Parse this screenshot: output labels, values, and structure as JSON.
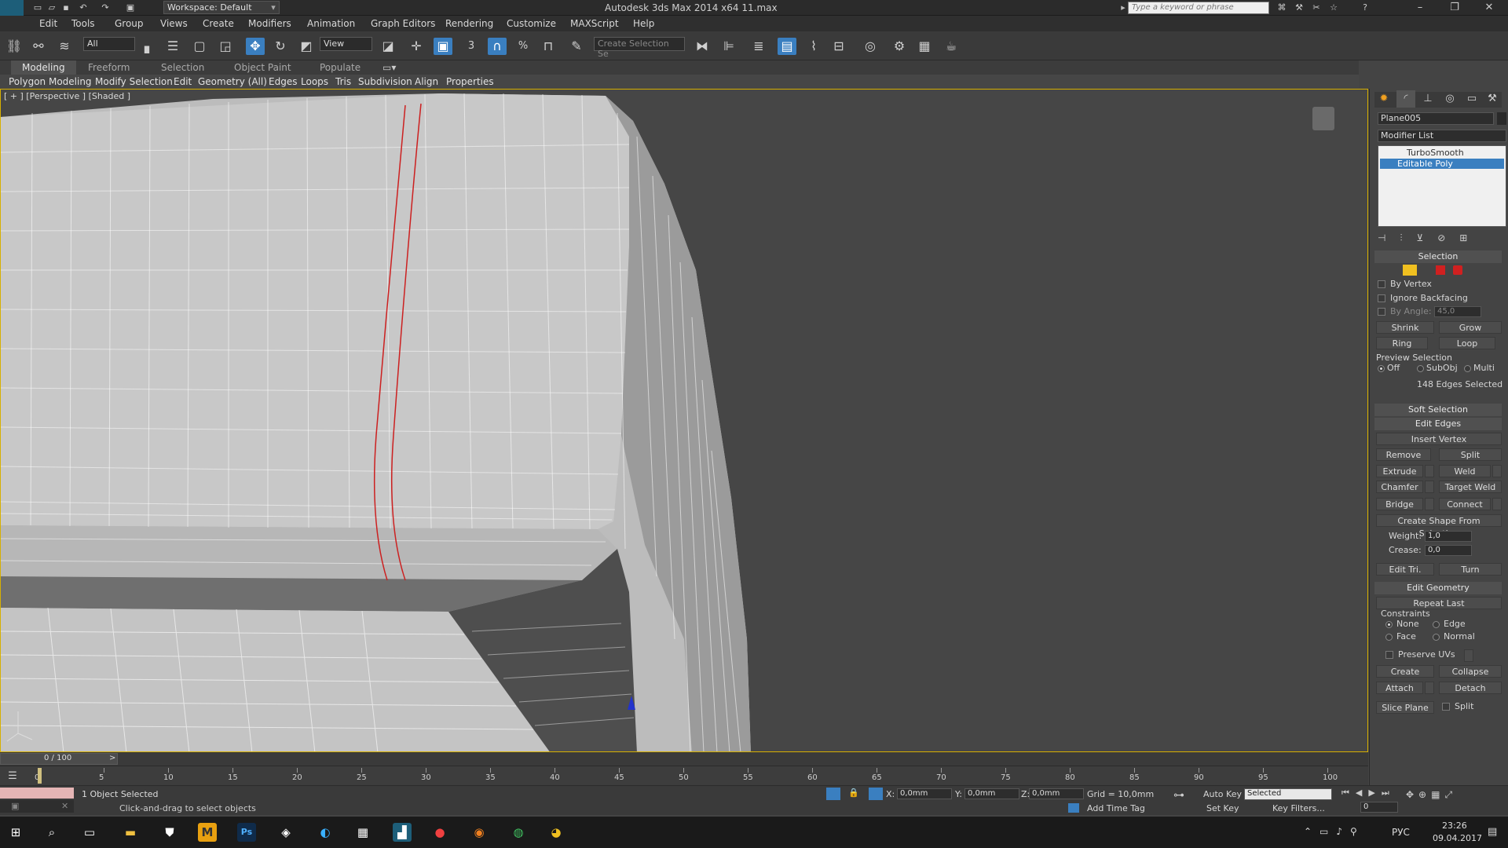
{
  "titlebar": {
    "title": "Autodesk 3ds Max  2014 x64      11.max",
    "workspace": "Workspace: Default",
    "search_placeholder": "Type a keyword or phrase"
  },
  "menu": [
    "Edit",
    "Tools",
    "Group",
    "Views",
    "Create",
    "Modifiers",
    "Animation",
    "Graph Editors",
    "Rendering",
    "Customize",
    "MAXScript",
    "Help"
  ],
  "toolbar": {
    "selection_filter": "All",
    "ref_coord": "View",
    "named_selection_placeholder": "Create Selection Se",
    "snap_angle_label": "3",
    "percent_snap_label": "%"
  },
  "ribbon": {
    "tabs": [
      "Modeling",
      "Freeform",
      "Selection",
      "Object Paint",
      "Populate"
    ],
    "subtabs": [
      "Polygon Modeling",
      "Modify Selection",
      "Edit",
      "Geometry (All)",
      "Edges",
      "Loops",
      "Tris",
      "Subdivision",
      "Align",
      "Properties"
    ]
  },
  "viewport": {
    "label": "[ + ] [Perspective ] [Shaded ]"
  },
  "command_panel": {
    "object_name": "Plane005",
    "modifier_list": "Modifier List",
    "stack": [
      {
        "name": "TurboSmooth",
        "selected": false
      },
      {
        "name": "Editable Poly",
        "selected": true
      }
    ],
    "selection": {
      "title": "Selection",
      "by_vertex": "By Vertex",
      "ignore_backfacing": "Ignore Backfacing",
      "by_angle": "By Angle:",
      "by_angle_value": "45,0",
      "shrink": "Shrink",
      "grow": "Grow",
      "ring": "Ring",
      "loop": "Loop",
      "preview_selection": "Preview Selection",
      "preview_off": "Off",
      "preview_subobj": "SubObj",
      "preview_multi": "Multi",
      "status": "148 Edges Selected"
    },
    "soft_selection": "Soft Selection",
    "edit_edges": {
      "title": "Edit Edges",
      "insert_vertex": "Insert Vertex",
      "remove": "Remove",
      "split": "Split",
      "extrude": "Extrude",
      "weld": "Weld",
      "chamfer": "Chamfer",
      "target_weld": "Target Weld",
      "bridge": "Bridge",
      "connect": "Connect",
      "create_shape": "Create Shape From Selection",
      "weight_label": "Weight:",
      "weight_value": "1,0",
      "crease_label": "Crease:",
      "crease_value": "0,0",
      "edit_tri": "Edit Tri.",
      "turn": "Turn"
    },
    "edit_geometry": {
      "title": "Edit Geometry",
      "repeat_last": "Repeat Last",
      "constraints": "Constraints",
      "none": "None",
      "edge": "Edge",
      "face": "Face",
      "normal": "Normal",
      "preserve_uvs": "Preserve UVs",
      "create": "Create",
      "collapse": "Collapse",
      "attach": "Attach",
      "detach": "Detach",
      "slice_plane": "Slice Plane",
      "split": "Split"
    }
  },
  "timeline": {
    "frame_counter": "0 / 100",
    "ticks": [
      "0",
      "5",
      "10",
      "15",
      "20",
      "25",
      "30",
      "35",
      "40",
      "45",
      "50",
      "55",
      "60",
      "65",
      "70",
      "75",
      "80",
      "85",
      "90",
      "95",
      "100"
    ]
  },
  "status": {
    "selected": "1 Object Selected",
    "prompt": "Click-and-drag to select objects",
    "x_label": "X:",
    "x_value": "0,0mm",
    "y_label": "Y:",
    "y_value": "0,0mm",
    "z_label": "Z:",
    "z_value": "0,0mm",
    "grid": "Grid = 10,0mm",
    "add_time_tag": "Add Time Tag",
    "auto_key": "Auto Key",
    "set_key": "Set Key",
    "key_mode": "Selected",
    "key_filters": "Key Filters...",
    "frame": "0"
  },
  "taskbar": {
    "lang": "РУС",
    "time": "23:26",
    "date": "09.04.2017"
  },
  "colors": {
    "accent": "#3a7fc0",
    "selected_edge": "#cc2020",
    "viewport_border": "#d7b000",
    "viewport_bg": "#464646"
  }
}
